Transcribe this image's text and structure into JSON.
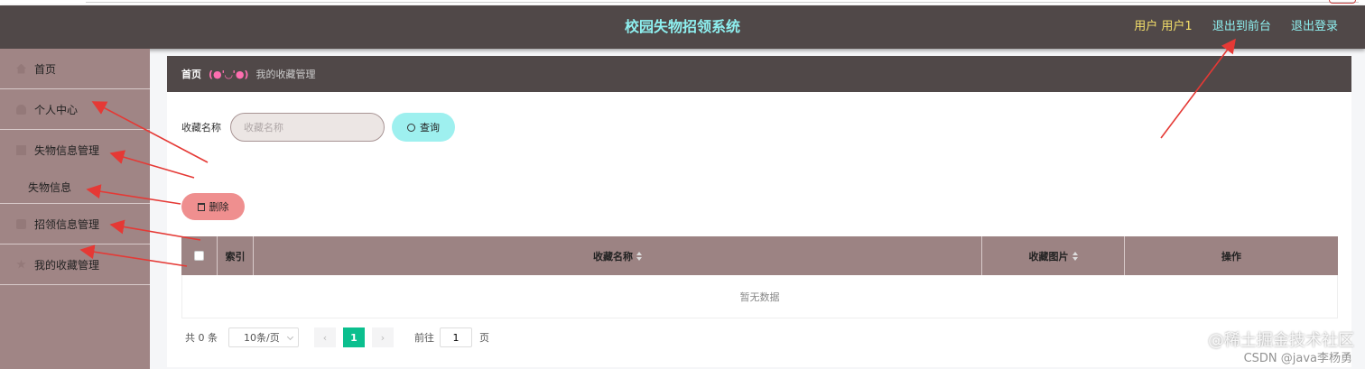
{
  "header": {
    "title": "校园失物招领系统",
    "user": "用户 用户1",
    "front_link": "退出到前台",
    "logout": "退出登录"
  },
  "sidebar": {
    "items": [
      {
        "label": "首页",
        "icon": "home-icon"
      },
      {
        "label": "个人中心",
        "icon": "user-icon"
      },
      {
        "label": "失物信息管理",
        "icon": "document-icon"
      },
      {
        "label": "失物信息",
        "icon": ""
      },
      {
        "label": "招领信息管理",
        "icon": "gift-icon"
      },
      {
        "label": "我的收藏管理",
        "icon": "star-icon"
      }
    ]
  },
  "breadcrumb": {
    "home": "首页",
    "separator": "(●'◡'●)",
    "current": "我的收藏管理"
  },
  "search": {
    "label": "收藏名称",
    "placeholder": "收藏名称",
    "query_button": "查询"
  },
  "actions": {
    "delete_button": "删除"
  },
  "table": {
    "columns": [
      "索引",
      "收藏名称",
      "收藏图片",
      "操作"
    ],
    "empty_text": "暂无数据"
  },
  "pagination": {
    "total": "共 0 条",
    "page_size": "10条/页",
    "current_page": "1",
    "goto_label": "前往",
    "goto_value": "1",
    "page_suffix": "页"
  },
  "watermark": {
    "line1": "@稀土掘金技术社区",
    "line2": "CSDN @java李杨勇"
  },
  "colors": {
    "header_bg": "#504848",
    "sidebar_bg": "#a08585",
    "accent_cyan": "#8ef0f0",
    "delete_red": "#ef8f8f",
    "page_active": "#0bbf8e"
  }
}
